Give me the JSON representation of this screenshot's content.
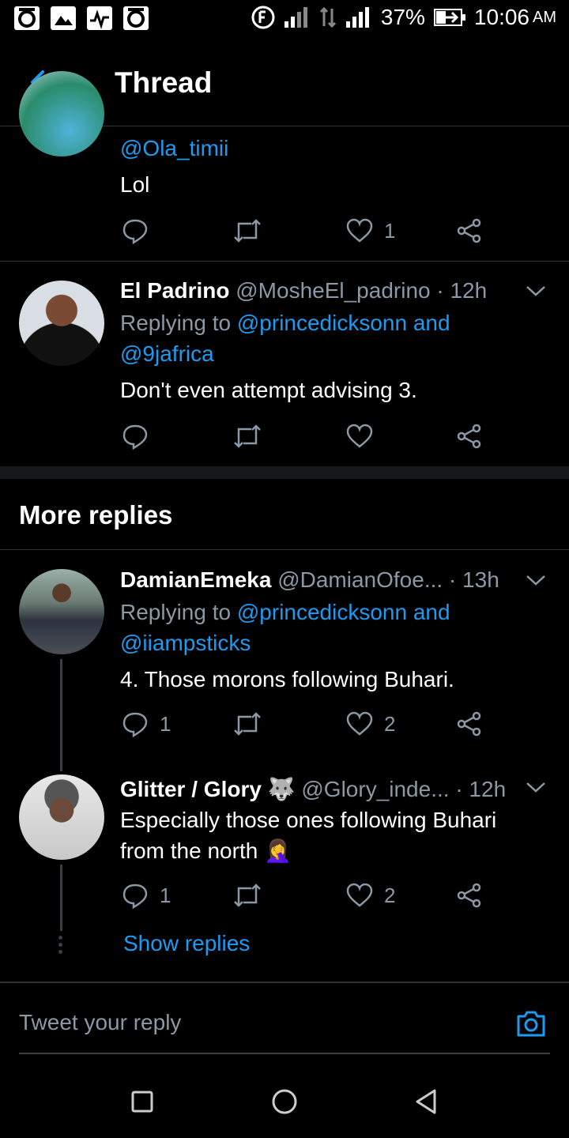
{
  "status_bar": {
    "battery": "37%",
    "time": "10:06",
    "ampm": "AM"
  },
  "header": {
    "title": "Thread"
  },
  "tweets": [
    {
      "handle_partial": "@Ola_timii",
      "text": "Lol",
      "reply_count": "",
      "like_count": "1"
    },
    {
      "name": "El Padrino",
      "handle": "@MosheEl_padrino",
      "time": "· 12h",
      "replying_prefix": "Replying to",
      "replying_1": "@princedicksonn and",
      "replying_2": "@9jafrica",
      "text": "Don't even attempt advising 3.",
      "reply_count": "",
      "like_count": ""
    }
  ],
  "more_replies": {
    "heading": "More replies"
  },
  "replies": [
    {
      "name": "DamianEmeka",
      "handle": "@DamianOfoe...",
      "time": "· 13h",
      "replying_prefix": "Replying to",
      "replying_1": "@princedicksonn and",
      "replying_2": "@iiampsticks",
      "text": "4. Those morons following Buhari.",
      "reply_count": "1",
      "like_count": "2"
    },
    {
      "name": "Glitter / Glory",
      "emoji_badge": "🐺",
      "handle": "@Glory_inde...",
      "time": "· 12h",
      "text_1": "Especially those ones following Buhari",
      "text_2": "from the north 🤦‍♀️",
      "reply_count": "1",
      "like_count": "2"
    }
  ],
  "show_replies": "Show replies",
  "compose": {
    "placeholder": "Tweet your reply"
  },
  "colors": {
    "accent": "#1d9bf0",
    "secondary_text": "#8b98a5",
    "background": "#000000"
  }
}
